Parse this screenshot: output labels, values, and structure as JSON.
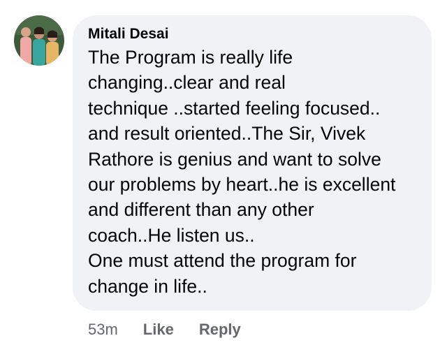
{
  "comment": {
    "author": "Mitali Desai",
    "text": "The Program is really life\nchanging..clear and real\ntechnique ..started feeling focused..\nand result oriented..The Sir, Vivek\nRathore is genius and want to solve\nour problems by heart..he is excellent\nand different than any other\ncoach..He listen us..\nOne must attend the program for\nchange in life..",
    "timestamp": "53m",
    "actions": {
      "like": "Like",
      "reply": "Reply"
    },
    "avatar_icon": "profile-photo-icon"
  },
  "colors": {
    "bubble_background": "#f0f2f5",
    "text": "#050505",
    "secondary_text": "#65676b"
  }
}
